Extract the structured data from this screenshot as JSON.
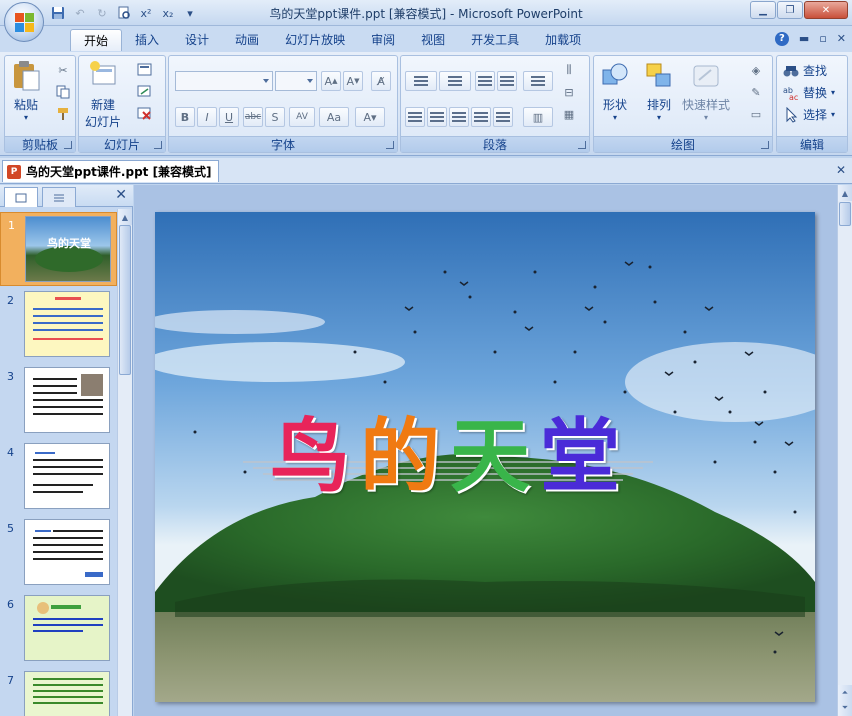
{
  "window": {
    "title": "鸟的天堂ppt课件.ppt [兼容模式] - Microsoft PowerPoint"
  },
  "qat": {
    "icons": [
      "save-icon",
      "undo-icon",
      "redo-icon",
      "print-preview-icon",
      "superscript-icon",
      "subscript-icon",
      "customize-icon"
    ],
    "superscript_label": "x²",
    "subscript_label": "x₂"
  },
  "tabs": [
    "开始",
    "插入",
    "设计",
    "动画",
    "幻灯片放映",
    "审阅",
    "视图",
    "开发工具",
    "加载项"
  ],
  "active_tab": "开始",
  "ribbon": {
    "clipboard": {
      "label": "剪贴板",
      "paste": "粘贴"
    },
    "slides": {
      "label": "幻灯片",
      "new_slide_line1": "新建",
      "new_slide_line2": "幻灯片"
    },
    "font": {
      "label": "字体"
    },
    "paragraph": {
      "label": "段落"
    },
    "drawing": {
      "label": "绘图",
      "shapes": "形状",
      "arrange": "排列",
      "quick_styles": "快速样式"
    },
    "editing": {
      "label": "编辑",
      "find": "查找",
      "replace": "替换",
      "select": "选择"
    }
  },
  "document_tab": {
    "title": "鸟的天堂ppt课件.ppt [兼容模式]"
  },
  "slides_panel": {
    "thumbnails": [
      {
        "num": "1",
        "selected": true
      },
      {
        "num": "2",
        "selected": false
      },
      {
        "num": "3",
        "selected": false
      },
      {
        "num": "4",
        "selected": false
      },
      {
        "num": "5",
        "selected": false
      },
      {
        "num": "6",
        "selected": false
      },
      {
        "num": "7",
        "selected": false
      }
    ],
    "thumb1_title": "鸟的天堂"
  },
  "slide": {
    "title_chars": [
      "鸟",
      "的",
      "天",
      "堂"
    ],
    "title_colors": [
      "#e8245a",
      "#f07a12",
      "#39b54a",
      "#4a2bd8"
    ]
  }
}
